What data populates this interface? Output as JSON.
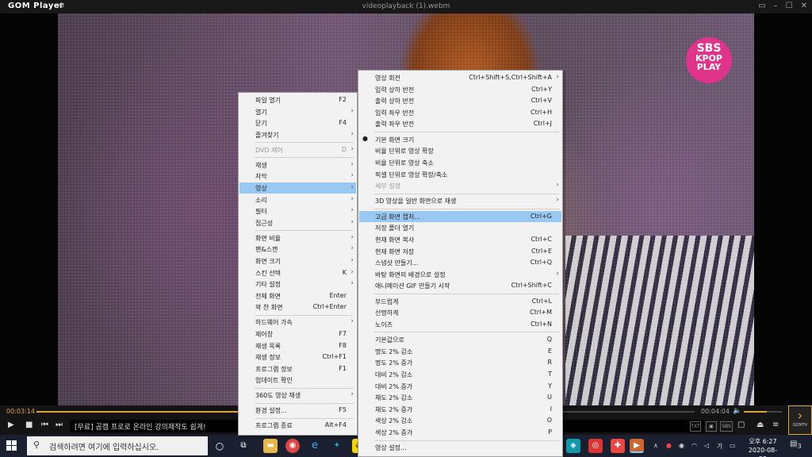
{
  "titlebar": {
    "app_name": "GOM Player",
    "file_name": "videoplayback (1).webm"
  },
  "overlay_logo": {
    "line1": "SBS",
    "line2": "KPOP",
    "line3": "PLAY"
  },
  "player": {
    "current_time": "00:03:14",
    "total_time": "00:04:04",
    "progress_fraction": 0.79,
    "volume_fraction": 0.6,
    "ticker_text": "[무료] 곰캠 프로로 온라인 강의제작도 쉽게!",
    "right_buttons": [
      "TXT",
      "SBS"
    ],
    "gomtv_label": "GOMTV"
  },
  "main_menu": {
    "items": [
      {
        "label": "파일 열기",
        "shortcut": "F2"
      },
      {
        "label": "열기",
        "arrow": true
      },
      {
        "label": "닫기",
        "shortcut": "F4"
      },
      {
        "label": "즐겨찾기",
        "arrow": true
      },
      {
        "sep": true
      },
      {
        "label": "DVD 제어",
        "shortcut": "D",
        "arrow": true,
        "disabled": true
      },
      {
        "sep": true
      },
      {
        "label": "재생",
        "arrow": true
      },
      {
        "label": "자막",
        "arrow": true
      },
      {
        "label": "영상",
        "arrow": true,
        "highlight": true
      },
      {
        "label": "소리",
        "arrow": true
      },
      {
        "label": "필터",
        "arrow": true
      },
      {
        "label": "접근성",
        "arrow": true
      },
      {
        "sep": true
      },
      {
        "label": "화면 비율",
        "arrow": true
      },
      {
        "label": "팬&스캔",
        "arrow": true
      },
      {
        "label": "화면 크기",
        "arrow": true
      },
      {
        "label": "스킨 선택",
        "shortcut": "K",
        "arrow": true
      },
      {
        "label": "기타 설정",
        "arrow": true
      },
      {
        "label": "전체 화면",
        "shortcut": "Enter"
      },
      {
        "label": "꽉 찬 화면",
        "shortcut": "Ctrl+Enter"
      },
      {
        "sep": true
      },
      {
        "label": "하드웨어 가속",
        "arrow": true
      },
      {
        "label": "제어창",
        "shortcut": "F7"
      },
      {
        "label": "재생 목록",
        "shortcut": "F8"
      },
      {
        "label": "재생 정보",
        "shortcut": "Ctrl+F1"
      },
      {
        "label": "프로그램 정보",
        "shortcut": "F1"
      },
      {
        "label": "업데이트 확인"
      },
      {
        "sep": true
      },
      {
        "label": "360도 영상 재생",
        "arrow": true
      },
      {
        "sep": true
      },
      {
        "label": "환경 설정...",
        "shortcut": "F5"
      },
      {
        "sep": true
      },
      {
        "label": "프로그램 종료",
        "shortcut": "Alt+F4"
      }
    ]
  },
  "sub_menu": {
    "items": [
      {
        "label": "영상 회전",
        "shortcut": "Ctrl+Shift+S,Ctrl+Shift+A",
        "arrow": true
      },
      {
        "label": "입력 상하 반전",
        "shortcut": "Ctrl+Y"
      },
      {
        "label": "출력 상하 반전",
        "shortcut": "Ctrl+V"
      },
      {
        "label": "입력 좌우 반전",
        "shortcut": "Ctrl+H"
      },
      {
        "label": "출력 좌우 반전",
        "shortcut": "Ctrl+J"
      },
      {
        "sep": true
      },
      {
        "label": "기본 화면 크기",
        "checked": true
      },
      {
        "label": "비율 단위로 영상 확장"
      },
      {
        "label": "비율 단위로 영상 축소"
      },
      {
        "label": "픽셀 단위로 영상 확장/축소"
      },
      {
        "label": "세부 설정",
        "arrow": true,
        "disabled": true
      },
      {
        "sep": true
      },
      {
        "label": "3D 영상을 일반 화면으로 재생",
        "arrow": true
      },
      {
        "sep": true
      },
      {
        "label": "고급 화면 캡처...",
        "shortcut": "Ctrl+G",
        "highlight": true
      },
      {
        "label": "저장 폴더 열기"
      },
      {
        "label": "현재 화면 복사",
        "shortcut": "Ctrl+C"
      },
      {
        "label": "현재 화면 저장",
        "shortcut": "Ctrl+E"
      },
      {
        "label": "스냅샷 만들기...",
        "shortcut": "Ctrl+Q"
      },
      {
        "label": "바탕 화면의 배경으로 설정",
        "arrow": true
      },
      {
        "label": "애니메이션 GIF 만들기 시작",
        "shortcut": "Ctrl+Shift+C"
      },
      {
        "sep": true
      },
      {
        "label": "부드럽게",
        "shortcut": "Ctrl+L"
      },
      {
        "label": "선명하게",
        "shortcut": "Ctrl+M"
      },
      {
        "label": "노이즈",
        "shortcut": "Ctrl+N"
      },
      {
        "sep": true
      },
      {
        "label": "기본값으로",
        "shortcut": "Q"
      },
      {
        "label": "명도    2% 감소",
        "shortcut": "E"
      },
      {
        "label": "명도    2% 증가",
        "shortcut": "R"
      },
      {
        "label": "대비    2% 감소",
        "shortcut": "T"
      },
      {
        "label": "대비    2% 증가",
        "shortcut": "Y"
      },
      {
        "label": "채도    2% 감소",
        "shortcut": "U"
      },
      {
        "label": "채도    2% 증가",
        "shortcut": "I"
      },
      {
        "label": "색상    2% 감소",
        "shortcut": "O"
      },
      {
        "label": "색상    2% 증가",
        "shortcut": "P"
      },
      {
        "sep": true
      },
      {
        "label": "영상 설정..."
      }
    ]
  },
  "taskbar": {
    "search_placeholder": "검색하려면 여기에 입력하십시오.",
    "time": "오후 6:27",
    "date": "2020-08-23",
    "notification_count": "3"
  }
}
